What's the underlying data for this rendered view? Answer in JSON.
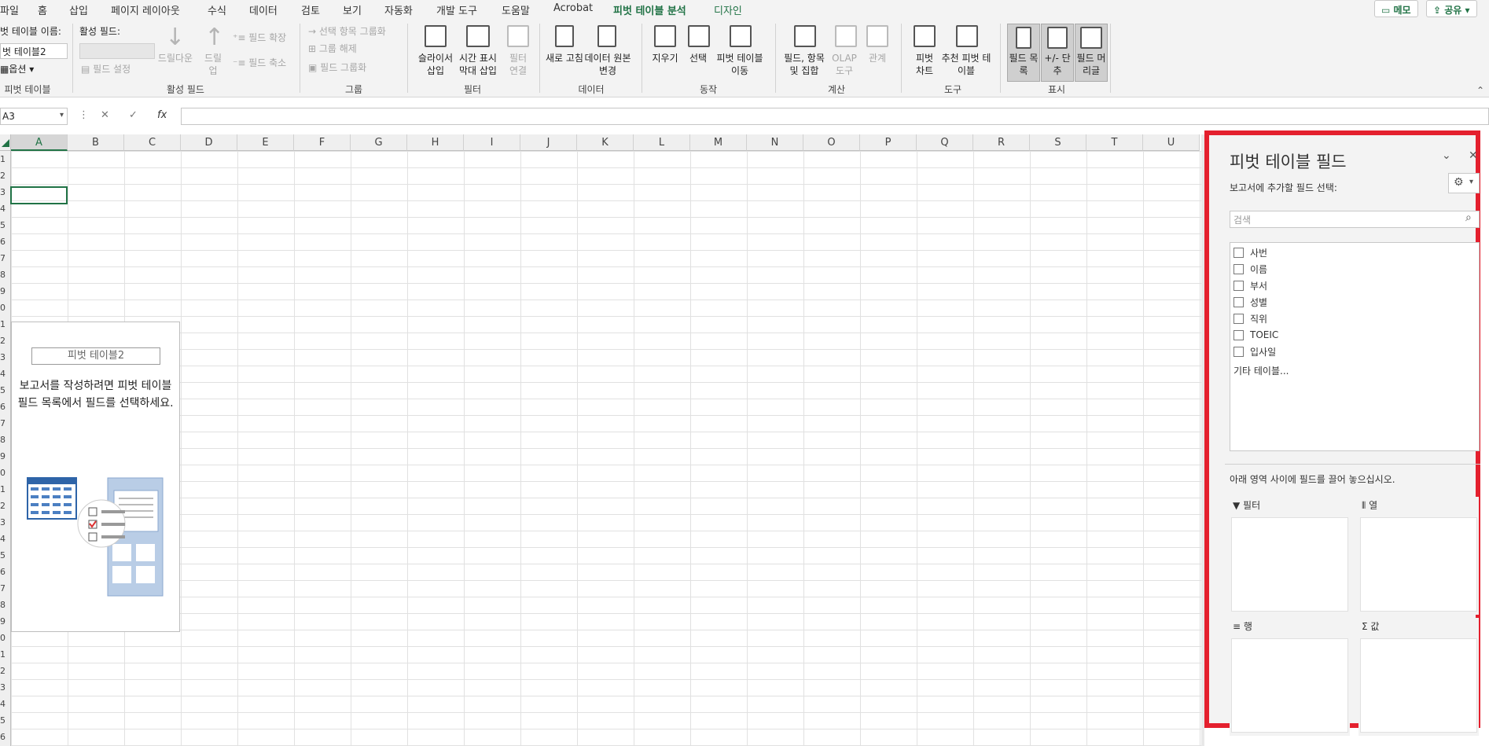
{
  "menu": {
    "tabs": [
      "파일",
      "홈",
      "삽입",
      "페이지 레이아웃",
      "수식",
      "데이터",
      "검토",
      "보기",
      "자동화",
      "개발 도구",
      "도움말",
      "Acrobat",
      "피벗 테이블 분석",
      "디자인"
    ],
    "active": "피벗 테이블 분석",
    "memo": "메모",
    "share": "공유"
  },
  "ribbon": {
    "pivot_name_label": "벗 테이블 이름:",
    "pivot_name_value": "벗 테이블2",
    "options": "옵션",
    "group_pivot": "피벗 테이블",
    "active_field_label": "활성 필드:",
    "field_settings": "필드 설정",
    "drill_down": "드릴다운",
    "drill_up": "드릴 업",
    "expand_field": "필드 확장",
    "collapse_field": "필드 축소",
    "group_active": "활성 필드",
    "group_selection": "선택 항목 그룹화",
    "ungroup": "그룹 해제",
    "group_field": "필드 그룹화",
    "group_group": "그룹",
    "slicer": "슬라이서 삽입",
    "timeline": "시간 표시 막대 삽입",
    "filter_conn": "필터 연결",
    "group_filter": "필터",
    "refresh": "새로 고침",
    "change_source": "데이터 원본 변경",
    "group_data": "데이터",
    "clear": "지우기",
    "select": "선택",
    "move_pivot": "피벗 테이블 이동",
    "group_action": "동작",
    "fields_items": "필드, 항목 및 집합",
    "olap": "OLAP 도구",
    "relations": "관계",
    "group_calc": "계산",
    "pivot_chart": "피벗 차트",
    "recommended": "추천 피벗 테이블",
    "group_tools": "도구",
    "field_list": "필드 목록",
    "plus_minus": "+/- 단추",
    "field_headers": "필드 머리글",
    "group_show": "표시"
  },
  "formula_bar": {
    "name_box": "A3",
    "cancel": "✕",
    "enter": "✓",
    "fx": "fx",
    "content": ""
  },
  "grid": {
    "columns": [
      "A",
      "B",
      "C",
      "D",
      "E",
      "F",
      "G",
      "H",
      "I",
      "J",
      "K",
      "L",
      "M",
      "N",
      "O",
      "P",
      "Q",
      "R",
      "S",
      "T",
      "U"
    ],
    "selected_column": "A",
    "rows": [
      "1",
      "2",
      "3",
      "4",
      "5",
      "6",
      "7",
      "8",
      "9",
      "0",
      "1",
      "2",
      "3",
      "4",
      "5",
      "6",
      "7",
      "8",
      "9",
      "0",
      "1",
      "2",
      "3",
      "4",
      "5",
      "6",
      "7",
      "8",
      "9",
      "0",
      "1",
      "2",
      "3",
      "4",
      "5",
      "6"
    ]
  },
  "pivot_placeholder": {
    "name": "피벗 테이블2",
    "message": "보고서를 작성하려면 피벗 테이블 필드 목록에서 필드를 선택하세요."
  },
  "panel": {
    "title": "피벗 테이블 필드",
    "subtitle": "보고서에 추가할 필드 선택:",
    "search_placeholder": "검색",
    "fields": [
      "사번",
      "이름",
      "부서",
      "성별",
      "직위",
      "TOEIC",
      "입사일"
    ],
    "more_tables": "기타 테이블...",
    "drag_hint": "아래 영역 사이에 필드를 끌어 놓으십시오.",
    "areas": {
      "filter": "필터",
      "columns": "열",
      "rows": "행",
      "values": "값"
    }
  },
  "colors": {
    "accent": "#217346",
    "highlight_border": "#e4202e"
  }
}
